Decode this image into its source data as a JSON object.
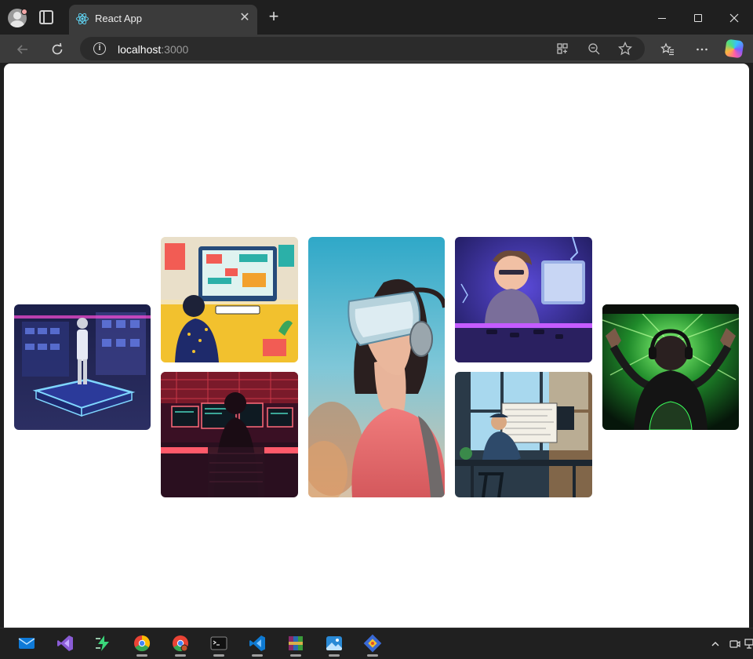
{
  "browser": {
    "tab_title": "React App",
    "tab_close_glyph": "✕",
    "new_tab_glyph": "+",
    "url_host": "localhost",
    "url_port": ":3000",
    "icons": [
      "profile-icon",
      "tab-actions-icon",
      "react-icon",
      "back-icon",
      "reload-icon",
      "site-info-icon",
      "app-available-icon",
      "zoom-out-icon",
      "favorite-star-icon",
      "favorites-icon",
      "more-icon",
      "copilot-icon"
    ]
  },
  "gallery": {
    "images": [
      {
        "name": "hologram-display",
        "desc": "man standing on neon glowing platform with holographic shelves"
      },
      {
        "name": "colorful-workspace",
        "desc": "illustrated person working at a colorful desk"
      },
      {
        "name": "red-hacker-room",
        "desc": "person at monitors in a red lit room"
      },
      {
        "name": "vr-headset-girl",
        "desc": "girl wearing a VR headset"
      },
      {
        "name": "purple-gamer",
        "desc": "cartoon gamer at a computer with purple lighting"
      },
      {
        "name": "architect-desk",
        "desc": "man drawing at a desk by a large window"
      },
      {
        "name": "green-gamer",
        "desc": "gamer with headphones in front of green screen"
      }
    ]
  },
  "taskbar": {
    "apps": [
      "mail-icon",
      "visual-studio-icon",
      "dev-tool-icon",
      "chrome-icon",
      "chrome-profile-icon",
      "terminal-icon",
      "vscode-icon",
      "winrar-icon",
      "photos-icon",
      "git-icon"
    ],
    "tray": [
      "show-hidden-icons-chevron",
      "meet-now-icon",
      "network-icon"
    ]
  },
  "colors": {
    "chrome_bg": "#1f1f1f",
    "toolbar_bg": "#3b3b3b",
    "page_bg": "#ffffff",
    "taskbar_bg": "#202020"
  }
}
